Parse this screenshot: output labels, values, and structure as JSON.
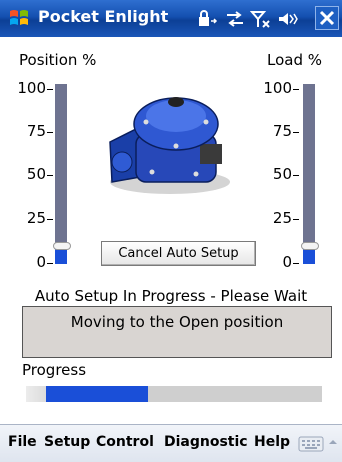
{
  "titlebar": {
    "title": "Pocket Enlight",
    "icons": [
      "windows-start-icon",
      "lock-sync-icon",
      "connectivity-icon",
      "signal-off-icon",
      "speaker-mute-icon",
      "close-icon"
    ]
  },
  "position_gauge": {
    "label": "Position %",
    "ticks": [
      "100",
      "75",
      "50",
      "25",
      "0"
    ],
    "value_percent": 10
  },
  "load_gauge": {
    "label": "Load %",
    "ticks": [
      "100",
      "75",
      "50",
      "25",
      "0"
    ],
    "value_percent": 10
  },
  "actuator_image": {
    "icon": "actuator-image"
  },
  "cancel_button": {
    "label": "Cancel Auto Setup"
  },
  "status": {
    "line": "Auto Setup In Progress - Please Wait",
    "message": "Moving to the Open position"
  },
  "progress": {
    "label": "Progress",
    "value_fraction": 0.37
  },
  "menubar": {
    "items": [
      "File",
      "Setup",
      "Control",
      "Diagnostic",
      "Help"
    ],
    "icons": [
      "keyboard-icon",
      "up-arrow-icon"
    ]
  },
  "colors": {
    "titlebar": "#1450b0",
    "bar_fill": "#1a4fd8",
    "track": "#6e7390",
    "message_bg": "#d9d5d2"
  }
}
